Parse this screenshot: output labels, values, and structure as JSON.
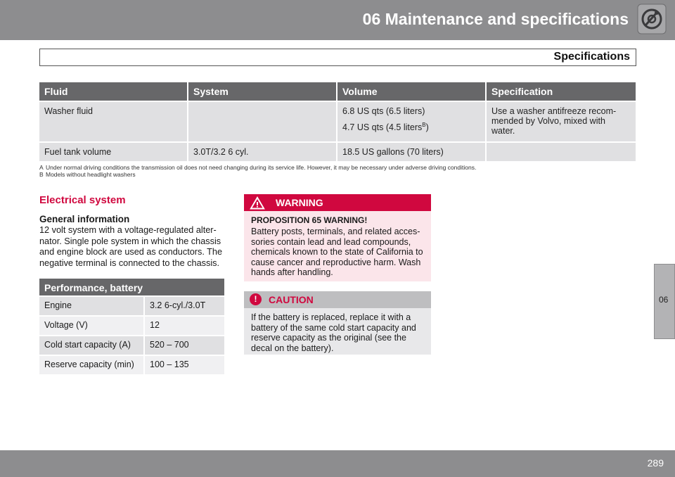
{
  "header": {
    "title": "06 Maintenance and specifications",
    "icon": "gear-wrench-icon"
  },
  "subheader": {
    "title": "Specifications"
  },
  "side_tab": {
    "label": "06"
  },
  "fluid_table": {
    "headers": [
      "Fluid",
      "System",
      "Volume",
      "Specification"
    ],
    "rows": [
      {
        "fluid": "Washer fluid",
        "system": "",
        "volume_1": "6.8 US qts (6.5 liters)",
        "volume_2": "4.7 US qts (4.5 liters",
        "volume_2_sup": "B",
        "volume_2_end": ")",
        "specification": "Use a washer antifreeze recom-mended by Volvo, mixed with water."
      },
      {
        "fluid": "Fuel tank volume",
        "system": "3.0T/3.2 6 cyl.",
        "volume": "18.5 US gallons (70 liters)",
        "specification": ""
      }
    ],
    "footnotes": [
      {
        "letter": "A",
        "text": "Under normal driving conditions the transmission oil does not need changing during its service life. However, it may be necessary under adverse driving conditions."
      },
      {
        "letter": "B",
        "text": "Models without headlight washers"
      }
    ]
  },
  "electrical": {
    "title": "Electrical system",
    "general_title": "General information",
    "general_body": "12 volt system with a voltage-regulated alter-nator. Single pole system in which the chassis and engine block are used as conductors. The negative terminal is connected to the chassis."
  },
  "battery_table": {
    "title": "Performance, battery",
    "rows": [
      {
        "label": "Engine",
        "value": "3.2 6-cyl./3.0T"
      },
      {
        "label": "Voltage (V)",
        "value": "12"
      },
      {
        "label": "Cold start capacity (A)",
        "value": "520 – 700"
      },
      {
        "label": "Reserve capacity (min)",
        "value": "100 – 135"
      }
    ]
  },
  "warning": {
    "label": "WARNING",
    "subtitle": "PROPOSITION 65 WARNING!",
    "body": "Battery posts, terminals, and related acces-sories contain lead and lead compounds, chemicals known to the state of California to cause cancer and reproductive harm. Wash hands after handling."
  },
  "caution": {
    "label": "CAUTION",
    "icon_glyph": "!",
    "body": "If the battery is replaced, replace it with a battery of the same cold start capacity and reserve capacity as the original (see the decal on the battery)."
  },
  "footer": {
    "page_number": "289"
  },
  "colors": {
    "header_gray": "#8d8d8f",
    "table_header": "#676769",
    "accent_red": "#d0083f",
    "warning_bg": "#fbe5ea"
  }
}
